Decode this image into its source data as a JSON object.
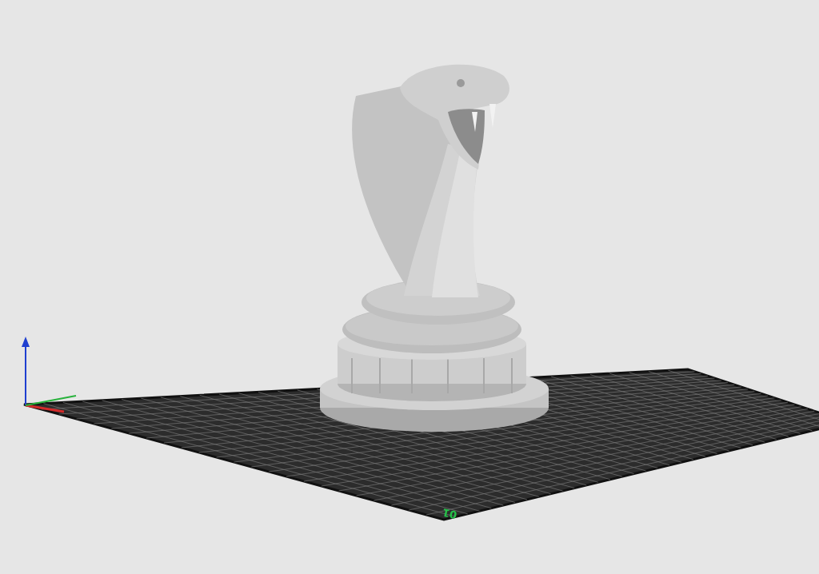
{
  "plate": {
    "label": "01"
  }
}
